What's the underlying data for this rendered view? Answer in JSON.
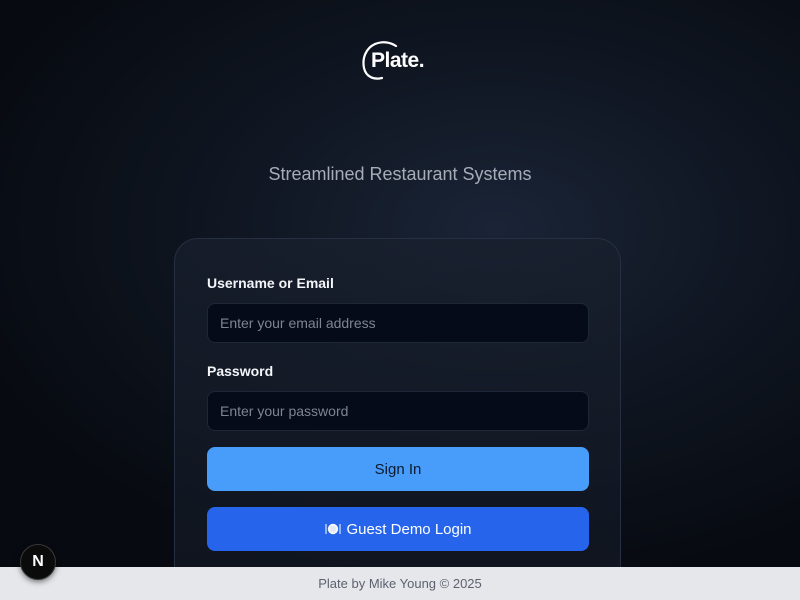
{
  "brand": {
    "logo_text": "Plate."
  },
  "tagline": "Streamlined Restaurant Systems",
  "login_form": {
    "username_label": "Username or Email",
    "username_placeholder": "Enter your email address",
    "username_value": "",
    "password_label": "Password",
    "password_placeholder": "Enter your password",
    "password_value": "",
    "signin_label": "Sign In",
    "guest_label": "Guest Demo Login",
    "guest_icon": "plate-cutlery-icon"
  },
  "footer": {
    "text": "Plate by Mike Young © 2025"
  },
  "dev_badge": {
    "letter": "N",
    "icon": "nextjs-logo-icon"
  },
  "colors": {
    "signin_button": "#489cfa",
    "guest_button": "#2564eb",
    "input_bg": "#050b18",
    "footer_bg": "#e6e7ea"
  }
}
